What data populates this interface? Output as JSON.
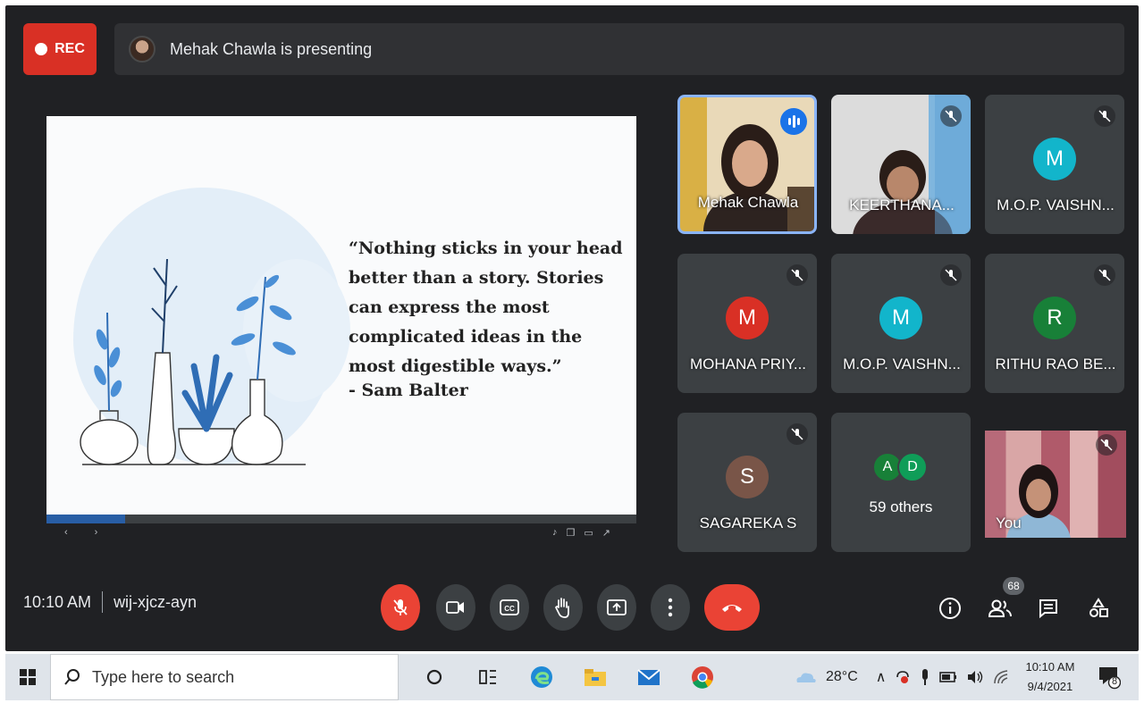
{
  "meet": {
    "rec_label": "REC",
    "presenter_text": "Mehak Chawla is presenting",
    "slide": {
      "quote": "“Nothing sticks in your head better than a story. Stories can express the most complicated ideas in the most digestible ways.”",
      "author": "- Sam Balter"
    },
    "participants": [
      {
        "name": "Mehak Chawla",
        "speaking": true
      },
      {
        "name": "KEERTHANA...",
        "muted": true
      },
      {
        "name": "M.O.P. VAISHN...",
        "initial": "M",
        "color": "#12b5cb",
        "muted": true
      },
      {
        "name": "MOHANA PRIY...",
        "initial": "M",
        "color": "#d93025",
        "muted": true
      },
      {
        "name": "M.O.P. VAISHN...",
        "initial": "M",
        "color": "#12b5cb",
        "muted": true
      },
      {
        "name": "RITHU RAO BE...",
        "initial": "R",
        "color": "#188038",
        "muted": true
      },
      {
        "name": "SAGAREKA S",
        "initial": "S",
        "color": "#795548",
        "muted": true
      },
      {
        "others_label": "59 others",
        "initials": [
          "A",
          "D"
        ]
      },
      {
        "name": "You",
        "muted": true
      }
    ],
    "time": "10:10 AM",
    "meeting_code": "wij-xjcz-ayn",
    "participant_count": "68"
  },
  "taskbar": {
    "search_placeholder": "Type here to search",
    "temperature": "28°C",
    "time": "10:10 AM",
    "date": "9/4/2021",
    "notification_count": "8"
  }
}
